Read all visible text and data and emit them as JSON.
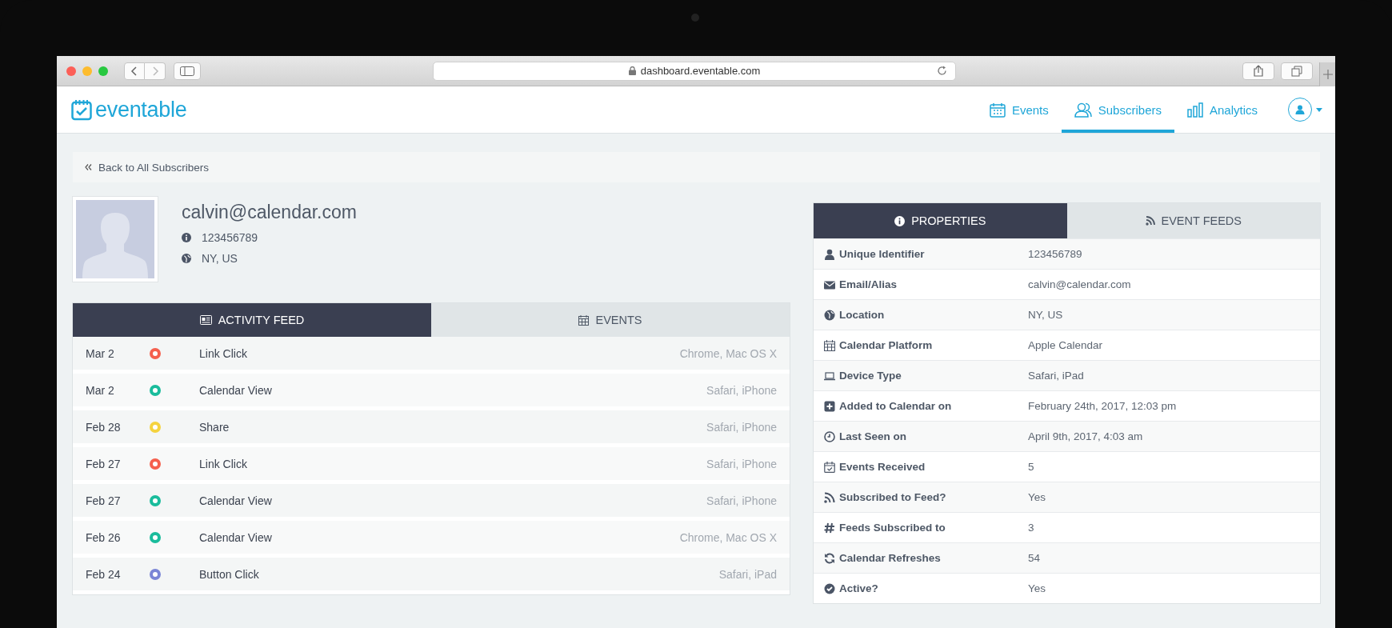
{
  "browser": {
    "url": "dashboard.eventable.com"
  },
  "header": {
    "logo": "eventable",
    "nav": [
      {
        "label": "Events",
        "selected": false
      },
      {
        "label": "Subscribers",
        "selected": true
      },
      {
        "label": "Analytics",
        "selected": false
      }
    ]
  },
  "back_link": "Back to All Subscribers",
  "profile": {
    "email": "calvin@calendar.com",
    "id": "123456789",
    "location": "NY, US"
  },
  "activity_tabs": [
    {
      "label": "ACTIVITY FEED",
      "selected": true
    },
    {
      "label": "EVENTS",
      "selected": false
    }
  ],
  "activity": [
    {
      "date": "Mar 2",
      "color": "#f5604e",
      "event": "Link Click",
      "device": "Chrome, Mac OS X"
    },
    {
      "date": "Mar 2",
      "color": "#1abc9c",
      "event": "Calendar View",
      "device": "Safari, iPhone"
    },
    {
      "date": "Feb 28",
      "color": "#f5d33f",
      "event": "Share",
      "device": "Safari, iPhone"
    },
    {
      "date": "Feb 27",
      "color": "#f5604e",
      "event": "Link Click",
      "device": "Safari, iPhone"
    },
    {
      "date": "Feb 27",
      "color": "#1abc9c",
      "event": "Calendar View",
      "device": "Safari, iPhone"
    },
    {
      "date": "Feb 26",
      "color": "#1abc9c",
      "event": "Calendar View",
      "device": "Chrome, Mac OS X"
    },
    {
      "date": "Feb 24",
      "color": "#7b86d6",
      "event": "Button Click",
      "device": "Safari, iPad"
    }
  ],
  "property_tabs": [
    {
      "label": "PROPERTIES",
      "selected": true
    },
    {
      "label": "EVENT FEEDS",
      "selected": false
    }
  ],
  "properties": [
    {
      "label": "Unique Identifier",
      "value": "123456789"
    },
    {
      "label": "Email/Alias",
      "value": "calvin@calendar.com"
    },
    {
      "label": "Location",
      "value": "NY, US"
    },
    {
      "label": "Calendar Platform",
      "value": "Apple Calendar"
    },
    {
      "label": "Device Type",
      "value": "Safari, iPad"
    },
    {
      "label": "Added to Calendar on",
      "value": "February 24th, 2017, 12:03 pm"
    },
    {
      "label": "Last Seen on",
      "value": "April 9th, 2017, 4:03 am"
    },
    {
      "label": "Events Received",
      "value": "5"
    },
    {
      "label": "Subscribed to Feed?",
      "value": "Yes"
    },
    {
      "label": "Feeds Subscribed to",
      "value": "3"
    },
    {
      "label": "Calendar Refreshes",
      "value": "54"
    },
    {
      "label": "Active?",
      "value": "Yes"
    }
  ]
}
